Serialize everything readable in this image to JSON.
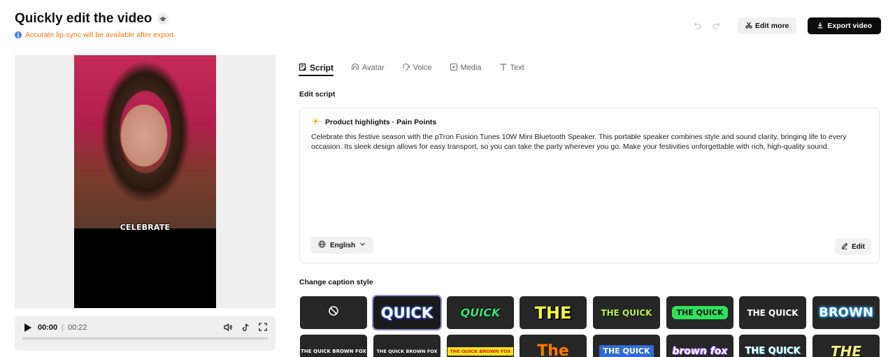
{
  "header": {
    "title": "Quickly edit the video",
    "notice": "Accurate lip-sync will be available after export.",
    "edit_more_label": "Edit more",
    "export_label": "Export video"
  },
  "player": {
    "caption_text": "CELEBRATE",
    "current_time": "00:00",
    "separator": "|",
    "duration": "00:22"
  },
  "tabs": [
    {
      "label": "Script",
      "icon": "script-icon",
      "active": true
    },
    {
      "label": "Avatar",
      "icon": "avatar-icon",
      "active": false
    },
    {
      "label": "Voice",
      "icon": "voice-icon",
      "active": false
    },
    {
      "label": "Media",
      "icon": "media-icon",
      "active": false
    },
    {
      "label": "Text",
      "icon": "text-icon",
      "active": false
    }
  ],
  "script": {
    "section_label": "Edit script",
    "heading": "Product highlights · Pain Points",
    "text": "Celebrate this festive season with the pTron Fusion Tunes 10W Mini Bluetooth Speaker. This portable speaker combines style and sound clarity, bringing life to every occasion. Its sleek design allows for easy transport, so you can take the party wherever you go. Make your festivities unforgettable with rich, high-quality sound.",
    "language": "English",
    "edit_label": "Edit"
  },
  "captions": {
    "section_label": "Change caption style",
    "styles": [
      {
        "text": "",
        "kind": "none"
      },
      {
        "text": "QUICK",
        "selected": true
      },
      {
        "text": "QUICK"
      },
      {
        "text": "THE"
      },
      {
        "text": "THE QUICK"
      },
      {
        "text": "THE QUICK"
      },
      {
        "text": "THE QUICK"
      },
      {
        "text": "BROWN"
      },
      {
        "text": "THE QUICK BROWN FOX"
      },
      {
        "text": "THE QUICK BROWN FOX"
      },
      {
        "text": "THE QUICK BROWN FOX"
      },
      {
        "text": "The"
      },
      {
        "text": "THE QUICK"
      },
      {
        "text": "brown fox"
      },
      {
        "text": "THE QUICK"
      },
      {
        "text": "THE"
      }
    ]
  },
  "colors": {
    "accent_orange": "#ee7a10",
    "info_blue": "#3b82f6",
    "export_bg": "#0c0c0c",
    "selected_outline": "#8f8fd6"
  }
}
